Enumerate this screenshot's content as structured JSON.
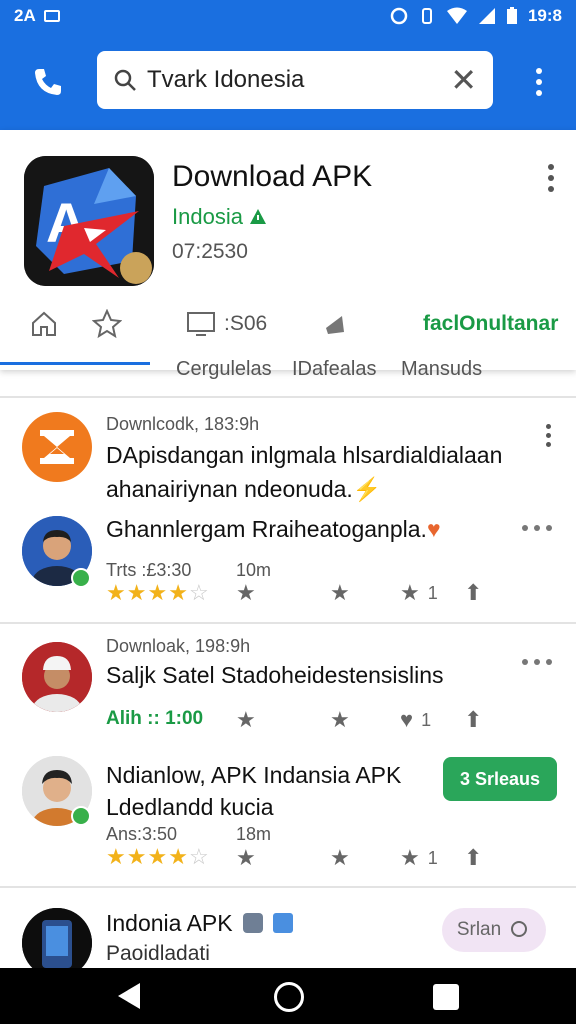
{
  "status": {
    "left_time": "2A",
    "right_time": "19:8"
  },
  "search": {
    "value": "Tvark Idonesia"
  },
  "app": {
    "title": "Download APK",
    "developer": "Indosia",
    "meta": "07:2530",
    "tabs": [
      {
        "label": ""
      },
      {
        "label": ""
      },
      {
        "label": ":S06"
      },
      {
        "label": ""
      },
      {
        "label": "faclOnultanar"
      }
    ]
  },
  "filters": [
    "Cergulelas",
    "IDafealas",
    "Mansuds"
  ],
  "posts": [
    {
      "source": "Downlcodk, 183:9h",
      "line1": "DApisdangan inlgmala hlsardialdialaan",
      "line2": "ahanairiynan ndeonuda.",
      "emoji": "⚡"
    },
    {
      "title": "Ghannlergam Rraiheatoganpla.",
      "emoji": "♥",
      "stat1": "Trts :£3:30",
      "stat2": "10m",
      "rating": 4,
      "count": "1"
    },
    {
      "source": "Downloak, 198:9h",
      "title": "Saljk Satel Stadoheidestensislins",
      "stat1": "Alih :: 1:00",
      "count": "1"
    },
    {
      "title1": "Ndianlow, APK Indansia APK",
      "title2": "Ldedlandd kucia",
      "button": "3 Srleaus",
      "stat1": "Ans:3:50",
      "stat2": "18m",
      "rating": 4,
      "count": "1"
    },
    {
      "title": "Indonia APK",
      "sub": "Paoidladati",
      "pill": "Srlan"
    }
  ],
  "colors": {
    "brand_blue": "#1a6fe0",
    "green": "#1a9a45",
    "star": "#f2b21a"
  }
}
